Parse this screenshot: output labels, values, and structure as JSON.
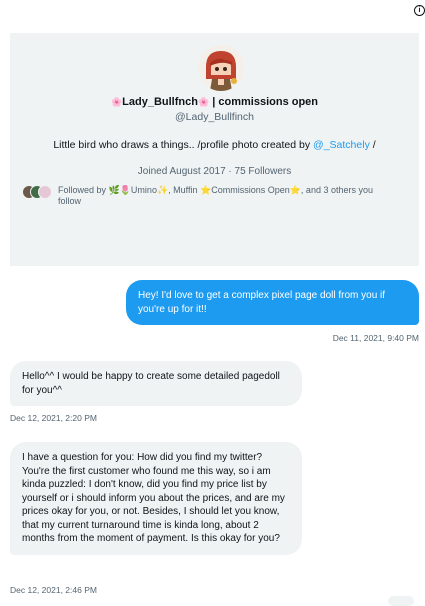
{
  "profile": {
    "display_name": "Lady_Bullfnch",
    "display_suffix": "| commissions open",
    "name_emoji": "🌸",
    "handle": "@Lady_Bullfinch",
    "bio_text": "Little bird who draws a things..   /profile photo created by ",
    "bio_mention": "@_Satchely",
    "bio_end": " /",
    "joined": "Joined August 2017 · 75 Followers",
    "followed_by_text": "Followed by 🌿🌷Umino✨, Muffin ⭐Commissions Open⭐, and 3 others you follow"
  },
  "messages": [
    {
      "direction": "outgoing",
      "text": "Hey! I'd love to get a complex pixel page doll from you if you're up for it!!",
      "timestamp": "Dec 11, 2021, 9:40 PM"
    },
    {
      "direction": "incoming",
      "text": "Hello^^ I would be happy to create some detailed pagedoll for you^^",
      "timestamp": "Dec 12, 2021, 2:20 PM"
    },
    {
      "direction": "incoming",
      "text": "I have a question for you: How did you find my twitter? You're the first customer who found me this way, so i am kinda puzzled: I don't know, did you find my price list by yourself or i should inform you about the prices, and are my prices okay for you, or not. Besides, I should let you know, that my current turnaround time is kinda long, about 2 months from the moment of payment. Is this okay for you?",
      "timestamp": "Dec 12, 2021, 2:46 PM"
    }
  ],
  "icons": {
    "info": "ⓘ",
    "info_label": "i"
  },
  "colors": {
    "accent": "#1d9bf0",
    "card_bg": "#eff3f4",
    "secondary_text": "#536471"
  }
}
